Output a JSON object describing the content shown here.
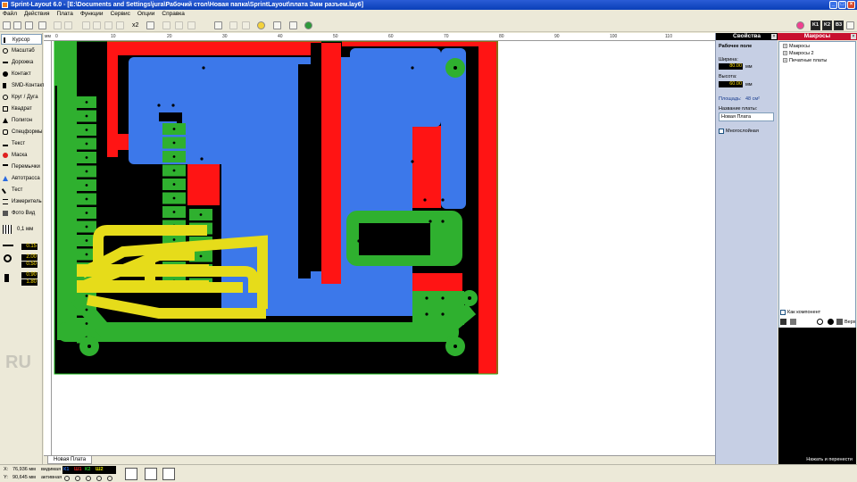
{
  "window": {
    "title": "Sprint-Layout 6.0 - [E:\\Documents and Settings\\jura\\Рабочий стол\\Новая папка\\SprintLayout\\плата Змм разъем.lay6]"
  },
  "menu": [
    "Файл",
    "Действия",
    "Плата",
    "Функции",
    "Сервис",
    "Опции",
    "Справка"
  ],
  "toolbar": {
    "zoom_factor": "x2",
    "layer_buttons": [
      "K1",
      "K2",
      "B3"
    ]
  },
  "tools": {
    "items": [
      {
        "label": "Курсор",
        "icon": "cursor-icon"
      },
      {
        "label": "Масштаб",
        "icon": "zoom-icon"
      },
      {
        "label": "Дорожка",
        "icon": "track-icon"
      },
      {
        "label": "Контакт",
        "icon": "pad-icon"
      },
      {
        "label": "SMD-Контакт",
        "icon": "smd-pad-icon"
      },
      {
        "label": "Круг / Дуга",
        "icon": "circle-arc-icon"
      },
      {
        "label": "Квадрат",
        "icon": "square-icon"
      },
      {
        "label": "Полигон",
        "icon": "polygon-icon"
      },
      {
        "label": "Спецформы",
        "icon": "special-shapes-icon"
      },
      {
        "label": "Текст",
        "icon": "text-icon"
      },
      {
        "label": "Маска",
        "icon": "mask-icon"
      },
      {
        "label": "Перемычки",
        "icon": "jumper-icon"
      },
      {
        "label": "Автотрасса",
        "icon": "autoroute-icon"
      },
      {
        "label": "Тест",
        "icon": "test-icon"
      },
      {
        "label": "Измеритель",
        "icon": "measure-icon"
      },
      {
        "label": "Фото Вид",
        "icon": "photo-view-icon"
      }
    ],
    "grid_value": "0,1 мм",
    "track_width": "0.15",
    "pad_outer": "2.00",
    "pad_inner": "0.50",
    "smd_w": "0.90",
    "smd_h": "1.80",
    "lang": "RU"
  },
  "ruler": {
    "unit": "мм",
    "ticks": [
      "0",
      "10",
      "20",
      "30",
      "40",
      "50",
      "60",
      "70",
      "80",
      "90",
      "100",
      "110"
    ]
  },
  "board_tab": "Новая Плата",
  "properties": {
    "title": "Свойства",
    "section": "Рабочее поле",
    "width_label": "Ширина:",
    "width_value": "80.00",
    "height_label": "Высота:",
    "height_value": "60.00",
    "unit": "мм",
    "area_label": "Площадь:",
    "area_value": "48 см²",
    "name_label": "Название платы:",
    "name_value": "Новая Плата",
    "multilayer_label": "Многослойная"
  },
  "macros": {
    "title": "Макросы",
    "items": [
      "Макросы",
      "Макросы 2",
      "Печатные платы"
    ],
    "as_component_label": "Как компонент",
    "top_label": "Верх",
    "caption": "Нажать и перенести"
  },
  "status": {
    "x_coord": "76,936 мм",
    "y_coord": "90,645 мм",
    "layers": [
      {
        "label": "К1",
        "color": "#2a6ae0"
      },
      {
        "label": "Ш1",
        "color": "#e02020"
      },
      {
        "label": "К2",
        "color": "#20c020"
      },
      {
        "label": "Ш2",
        "color": "#e0e000"
      }
    ],
    "visible_label": "видимая",
    "active_label": "активная"
  },
  "colors": {
    "board_bg": "#000000",
    "copper_top": "#3c78ea",
    "copper_bottom": "#2fb02f",
    "silk_top": "#ff1414",
    "silk_bottom": "#e6dc1a"
  }
}
